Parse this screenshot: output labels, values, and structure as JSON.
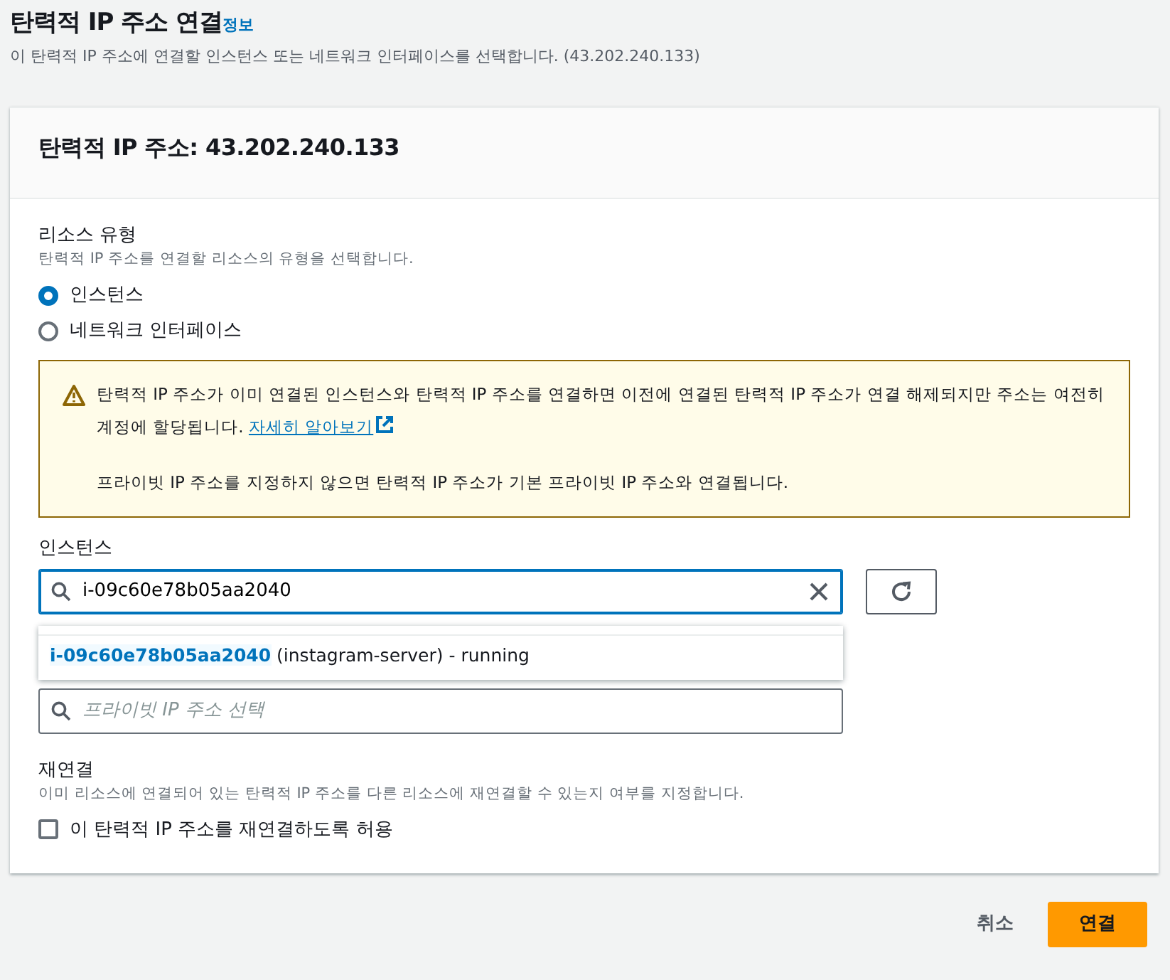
{
  "page": {
    "title": "탄력적 IP 주소 연결",
    "info_link": "정보",
    "description": "이 탄력적 IP 주소에 연결할 인스턴스 또는 네트워크 인터페이스를 선택합니다. (43.202.240.133)"
  },
  "panel": {
    "title": "탄력적 IP 주소: 43.202.240.133"
  },
  "resource_type": {
    "label": "리소스 유형",
    "description": "탄력적 IP 주소를 연결할 리소스의 유형을 선택합니다.",
    "options": [
      {
        "label": "인스턴스",
        "selected": true
      },
      {
        "label": "네트워크 인터페이스",
        "selected": false
      }
    ]
  },
  "alert": {
    "text": "탄력적 IP 주소가 이미 연결된 인스턴스와 탄력적 IP 주소를 연결하면 이전에 연결된 탄력적 IP 주소가 연결 해제되지만 주소는 여전히 계정에 할당됩니다.",
    "link": "자세히 알아보기",
    "note": "프라이빗 IP 주소를 지정하지 않으면 탄력적 IP 주소가 기본 프라이빗 IP 주소와 연결됩니다."
  },
  "instance": {
    "label": "인스턴스",
    "value": "i-09c60e78b05aa2040",
    "suggestions": [
      {
        "id": "i-09c60e78b05aa2040",
        "detail": "(instagram-server) - running"
      }
    ]
  },
  "private_ip": {
    "placeholder": "프라이빗 IP 주소 선택"
  },
  "reassociate": {
    "label": "재연결",
    "description": "이미 리소스에 연결되어 있는 탄력적 IP 주소를 다른 리소스에 재연결할 수 있는지 여부를 지정합니다.",
    "checkbox": "이 탄력적 IP 주소를 재연결하도록 허용",
    "checked": false
  },
  "buttons": [
    {
      "label": "취소",
      "kind": "link"
    },
    {
      "label": "연결",
      "kind": "primary"
    }
  ]
}
